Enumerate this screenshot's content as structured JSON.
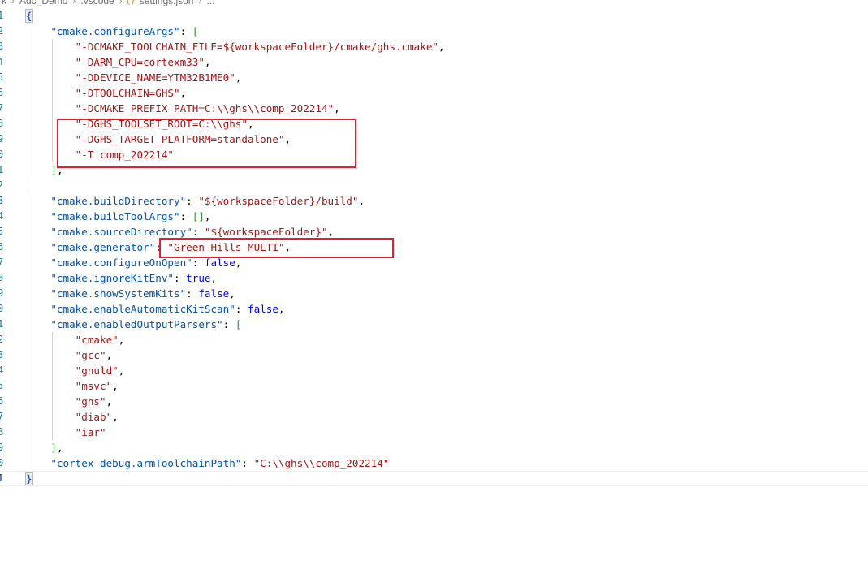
{
  "breadcrumb": {
    "segments": [
      "k",
      "Adc_Demo",
      ".vscode",
      "settings.json",
      "..."
    ],
    "file_icon": "json-braces-icon",
    "file_icon_glyph": "{}"
  },
  "editor": {
    "language": "json",
    "line_numbers": [
      "1",
      "2",
      "3",
      "4",
      "5",
      "6",
      "7",
      "8",
      "9",
      "0",
      "1",
      "2",
      "3",
      "4",
      "5",
      "6",
      "7",
      "8",
      "9",
      "0",
      "1",
      "2",
      "3",
      "4",
      "5",
      "6",
      "7",
      "8",
      "9",
      "0",
      "1"
    ],
    "active_line": 31,
    "lines": [
      [
        {
          "t": "{",
          "c": "br1"
        }
      ],
      [
        {
          "t": "    "
        },
        {
          "t": "\"cmake.configureArgs\"",
          "c": "key"
        },
        {
          "t": ": ",
          "c": "pun"
        },
        {
          "t": "[",
          "c": "br2"
        }
      ],
      [
        {
          "t": "        "
        },
        {
          "t": "\"-DCMAKE_TOOLCHAIN_FILE=${workspaceFolder}/cmake/ghs.cmake\"",
          "c": "str"
        },
        {
          "t": ",",
          "c": "pun"
        }
      ],
      [
        {
          "t": "        "
        },
        {
          "t": "\"-DARM_CPU=cortexm33\"",
          "c": "str"
        },
        {
          "t": ",",
          "c": "pun"
        }
      ],
      [
        {
          "t": "        "
        },
        {
          "t": "\"-DDEVICE_NAME=YTM32B1ME0\"",
          "c": "str"
        },
        {
          "t": ",",
          "c": "pun"
        }
      ],
      [
        {
          "t": "        "
        },
        {
          "t": "\"-DTOOLCHAIN=GHS\"",
          "c": "str"
        },
        {
          "t": ",",
          "c": "pun"
        }
      ],
      [
        {
          "t": "        "
        },
        {
          "t": "\"-DCMAKE_PREFIX_PATH=C:\\\\ghs\\\\comp_202214\"",
          "c": "str"
        },
        {
          "t": ",",
          "c": "pun"
        }
      ],
      [
        {
          "t": "        "
        },
        {
          "t": "\"-DGHS_TOOLSET_ROOT=C:\\\\ghs\"",
          "c": "str"
        },
        {
          "t": ",",
          "c": "pun"
        }
      ],
      [
        {
          "t": "        "
        },
        {
          "t": "\"-DGHS_TARGET_PLATFORM=standalone\"",
          "c": "str"
        },
        {
          "t": ",",
          "c": "pun"
        }
      ],
      [
        {
          "t": "        "
        },
        {
          "t": "\"-T comp_202214\"",
          "c": "str"
        }
      ],
      [
        {
          "t": "    "
        },
        {
          "t": "]",
          "c": "br2"
        },
        {
          "t": ",",
          "c": "pun"
        }
      ],
      [],
      [
        {
          "t": "    "
        },
        {
          "t": "\"cmake.buildDirectory\"",
          "c": "key"
        },
        {
          "t": ": ",
          "c": "pun"
        },
        {
          "t": "\"${workspaceFolder}/build\"",
          "c": "str"
        },
        {
          "t": ",",
          "c": "pun"
        }
      ],
      [
        {
          "t": "    "
        },
        {
          "t": "\"cmake.buildToolArgs\"",
          "c": "key"
        },
        {
          "t": ": ",
          "c": "pun"
        },
        {
          "t": "[]",
          "c": "br2"
        },
        {
          "t": ",",
          "c": "pun"
        }
      ],
      [
        {
          "t": "    "
        },
        {
          "t": "\"cmake.sourceDirectory\"",
          "c": "key"
        },
        {
          "t": ": ",
          "c": "pun"
        },
        {
          "t": "\"${workspaceFolder}\"",
          "c": "str"
        },
        {
          "t": ",",
          "c": "pun"
        }
      ],
      [
        {
          "t": "    "
        },
        {
          "t": "\"cmake.generator\"",
          "c": "key"
        },
        {
          "t": ": ",
          "c": "pun"
        },
        {
          "t": "\"Green Hills MULTI\"",
          "c": "str"
        },
        {
          "t": ",",
          "c": "pun"
        }
      ],
      [
        {
          "t": "    "
        },
        {
          "t": "\"cmake.configureOnOpen\"",
          "c": "key"
        },
        {
          "t": ": ",
          "c": "pun"
        },
        {
          "t": "false",
          "c": "kw"
        },
        {
          "t": ",",
          "c": "pun"
        }
      ],
      [
        {
          "t": "    "
        },
        {
          "t": "\"cmake.ignoreKitEnv\"",
          "c": "key"
        },
        {
          "t": ": ",
          "c": "pun"
        },
        {
          "t": "true",
          "c": "kw"
        },
        {
          "t": ",",
          "c": "pun"
        }
      ],
      [
        {
          "t": "    "
        },
        {
          "t": "\"cmake.showSystemKits\"",
          "c": "key"
        },
        {
          "t": ": ",
          "c": "pun"
        },
        {
          "t": "false",
          "c": "kw"
        },
        {
          "t": ",",
          "c": "pun"
        }
      ],
      [
        {
          "t": "    "
        },
        {
          "t": "\"cmake.enableAutomaticKitScan\"",
          "c": "key"
        },
        {
          "t": ": ",
          "c": "pun"
        },
        {
          "t": "false",
          "c": "kw"
        },
        {
          "t": ",",
          "c": "pun"
        }
      ],
      [
        {
          "t": "    "
        },
        {
          "t": "\"cmake.enabledOutputParsers\"",
          "c": "key"
        },
        {
          "t": ": ",
          "c": "pun"
        },
        {
          "t": "[",
          "c": "br2"
        }
      ],
      [
        {
          "t": "        "
        },
        {
          "t": "\"cmake\"",
          "c": "str"
        },
        {
          "t": ",",
          "c": "pun"
        }
      ],
      [
        {
          "t": "        "
        },
        {
          "t": "\"gcc\"",
          "c": "str"
        },
        {
          "t": ",",
          "c": "pun"
        }
      ],
      [
        {
          "t": "        "
        },
        {
          "t": "\"gnuld\"",
          "c": "str"
        },
        {
          "t": ",",
          "c": "pun"
        }
      ],
      [
        {
          "t": "        "
        },
        {
          "t": "\"msvc\"",
          "c": "str"
        },
        {
          "t": ",",
          "c": "pun"
        }
      ],
      [
        {
          "t": "        "
        },
        {
          "t": "\"ghs\"",
          "c": "str"
        },
        {
          "t": ",",
          "c": "pun"
        }
      ],
      [
        {
          "t": "        "
        },
        {
          "t": "\"diab\"",
          "c": "str"
        },
        {
          "t": ",",
          "c": "pun"
        }
      ],
      [
        {
          "t": "        "
        },
        {
          "t": "\"iar\"",
          "c": "str"
        }
      ],
      [
        {
          "t": "    "
        },
        {
          "t": "]",
          "c": "br2"
        },
        {
          "t": ",",
          "c": "pun"
        }
      ],
      [
        {
          "t": "    "
        },
        {
          "t": "\"cortex-debug.armToolchainPath\"",
          "c": "key"
        },
        {
          "t": ": ",
          "c": "pun"
        },
        {
          "t": "\"C:\\\\ghs\\\\comp_202214\"",
          "c": "str"
        }
      ],
      [
        {
          "t": "}",
          "c": "br1"
        }
      ]
    ]
  },
  "colors": {
    "line_number": "#237893",
    "key": "#0451a5",
    "string": "#a31515",
    "keyword": "#0000ff",
    "bracket_level1": "#0431fa",
    "bracket_level2": "#319331",
    "annotation_box": "#e0202e"
  },
  "annotations": [
    {
      "name": "highlight-ghs-args-box",
      "lines": [
        8,
        10
      ]
    },
    {
      "name": "highlight-generator-box",
      "lines": [
        16,
        16
      ]
    }
  ]
}
